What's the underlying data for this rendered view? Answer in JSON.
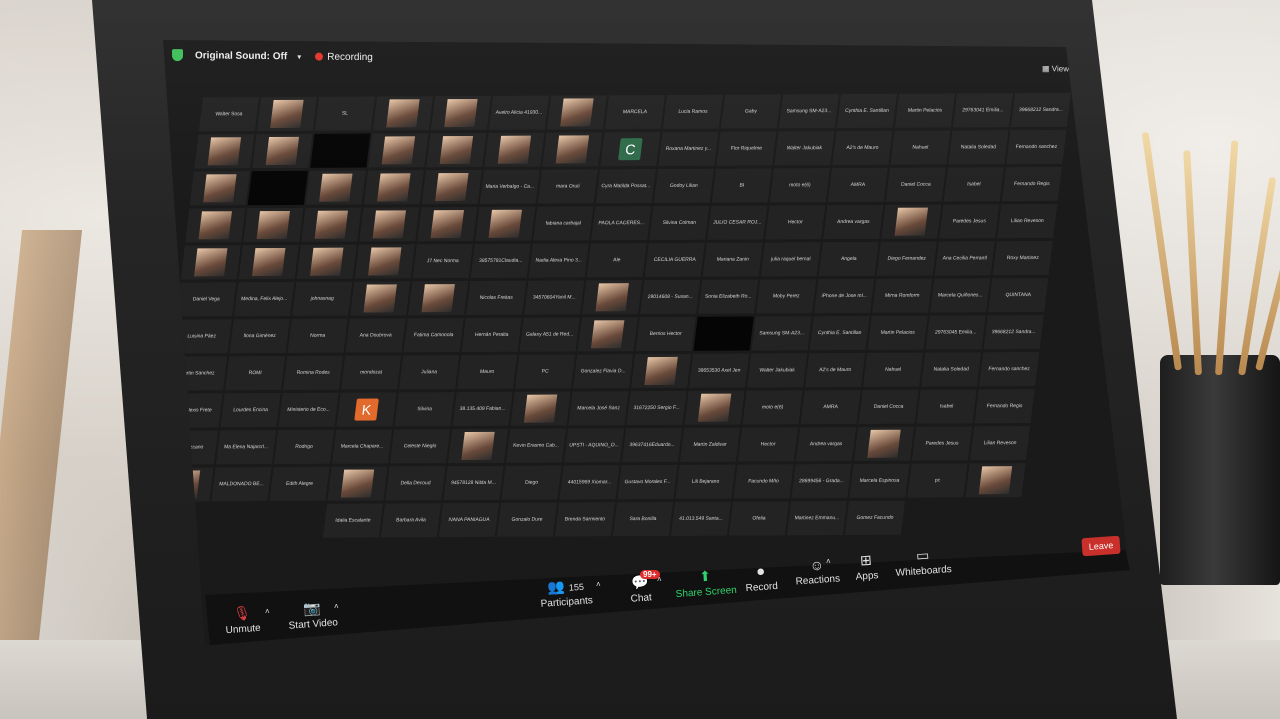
{
  "meeting": {
    "audio_label": "Original Sound: Off",
    "recording_label": "Recording",
    "view_label": "View",
    "leave_label": "Leave"
  },
  "controls": {
    "unmute": "Unmute",
    "start_video": "Start Video",
    "participants": "Participants",
    "participants_count": "155",
    "chat": "Chat",
    "chat_badge": "99+",
    "share_screen": "Share Screen",
    "record": "Record",
    "reactions": "Reactions",
    "apps": "Apps",
    "whiteboards": "Whiteboards"
  },
  "colors": {
    "accent_green": "#2fd36b",
    "leave_red": "#c9302c",
    "recording_red": "#e0352c"
  },
  "grid": {
    "rows": [
      [
        "Walter Sosa",
        "",
        "SL",
        "",
        "",
        "Avelro Alicia 41930...",
        "",
        "MARCELA",
        "Lucia Ramos",
        "Gaby",
        "Samsung SM-A23...",
        "Cynthia E. Santillan",
        "Martin Pelacios",
        "29763041 Emilia...",
        "39668212 Sandra..."
      ],
      [
        "",
        "",
        "",
        "",
        "",
        "",
        "",
        "C",
        "Roxana Martinez y...",
        "Flor Riquelme",
        "Walter Jakubiak",
        "A2's de Mauro",
        "Nahuel",
        "Natalia Soledad",
        "Fernando sanchez"
      ],
      [
        "",
        "",
        "",
        "",
        "",
        "Maria Verbalgo - Ca...",
        "mara Oruti",
        "Cyra Matilda Possat...",
        "Godoy Lilian",
        "BI",
        "moto e(6)",
        "AMRA",
        "Daniel Cocca",
        "Isabel",
        "Fernando Regis"
      ],
      [
        "",
        "",
        "",
        "",
        "",
        "",
        "fabiana carbajal",
        "PAOLA CACERES...",
        "Silvina Colman",
        "JULIO CESAR ROJ...",
        "Hector",
        "Andrea vargas",
        "",
        "Paredes Jesus",
        "Lilian Reveson"
      ],
      [
        "",
        "",
        "",
        "",
        "J7 Nec Norma",
        "38575781Claudia...",
        "Nadia Alexa Pino 3...",
        "Ale",
        "CECILIA GUERRA",
        "Mariana Zanin",
        "julia raquel bernal",
        "Angela",
        "Diego Fernandez",
        "Ana Cecilia Perrantl",
        "Roxy Martinez"
      ],
      [
        "Daniel Vega",
        "Medina, Felix Alejo...",
        "johnasnag",
        "",
        "",
        "Nicolas Freitas",
        "34570604Yanil M...",
        "",
        "28014608 - Susan...",
        "Sonia Elizabeth Ro...",
        "Moby Perez",
        "iPhone de Jose ml...",
        "Mirna Romform",
        "Marcela Quiñones...",
        "QUINTANA"
      ],
      [
        "Luisina Páez",
        "Ilona Giménez",
        "Norma",
        "Ana Doubrova",
        "Fatima Camooola",
        "Hernán Peralta",
        "Galaxy A51 de Red...",
        "",
        "Berrios Hector",
        "",
        "Samsung SM-A23...",
        "Cynthia E. Santillan",
        "Martin Pelacios",
        "29763045 Emilia...",
        "39668212 Sandra..."
      ],
      [
        "Martin Sanchez",
        "ROMI",
        "Romina Rodes",
        "mondozat",
        "Juliana",
        "Mauro",
        "PC",
        "Gonzalez Flavia D...",
        "",
        "38653530 Axel Jen",
        "Walter Jakubiak",
        "A2's de Mauro",
        "Nahuel",
        "Natalia Soledad",
        "Fernando sanchez"
      ],
      [
        "José Alexis Frete",
        "Lourdes Encina",
        "Ministerio de Eco...",
        "K",
        "Silvina",
        "38.135.409 Fabian...",
        "",
        "Marcela José Sanz",
        "31672250 Sergio F...",
        "",
        "moto e(6)",
        "AMRA",
        "Daniel Cocca",
        "Isabel",
        "Fernando Regis"
      ],
      [
        "lisura lezcano",
        "Ma Elena Najarcrl...",
        "Rodrigo",
        "Marcela Chapare...",
        "Celeste Nieglo",
        "",
        "Kevin Erasmo Cab...",
        "UPSTI - AQUINO_O...",
        "39637416Eduardo...",
        "Martin Zaldivar",
        "Hector",
        "Andrea vargas",
        "",
        "Paredes Jesus",
        "Lilian Reveson"
      ],
      [
        "",
        "MALDONADO BE...",
        "Edith Alegre",
        "",
        "Della Decoud",
        "94578128 Nilda M...",
        "Diego",
        "44015969 Xiomar...",
        "Gustavo Morales F...",
        "Lili Bejarano",
        "Facundo Mño",
        "28699456 - Grada...",
        "Marcela Espinosa",
        "pc",
        ""
      ],
      [
        "Idalia Escalante",
        "Barbara Avila",
        "IVANA PANIAGUA",
        "Gonzalo Dure",
        "Brenda Sarmiento",
        "Sara Bonilla",
        "41.013.549 Santa...",
        "Ofelia",
        "Martinez Emmanu...",
        "Gomez Facundo"
      ]
    ]
  }
}
